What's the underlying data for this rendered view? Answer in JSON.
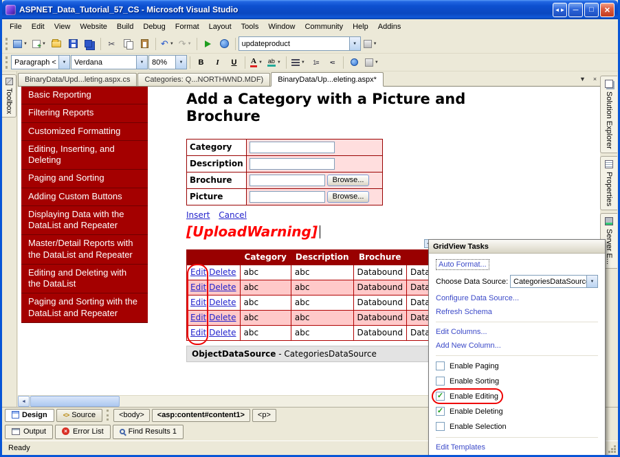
{
  "window": {
    "title": "ASPNET_Data_Tutorial_57_CS - Microsoft Visual Studio"
  },
  "menu": {
    "items": [
      "File",
      "Edit",
      "View",
      "Website",
      "Build",
      "Debug",
      "Format",
      "Layout",
      "Tools",
      "Window",
      "Community",
      "Help",
      "Addins"
    ]
  },
  "toolbar1": {
    "combo_value": "updateproduct"
  },
  "toolbar2": {
    "block_format": "Paragraph <",
    "font": "Verdana",
    "font_size": "80%",
    "bold": "B",
    "italic": "I",
    "underline": "U"
  },
  "tabstrip": {
    "tabs": [
      "BinaryData/Upd...leting.aspx.cs",
      "Categories: Q...NORTHWND.MDF)",
      "BinaryData/Up...eleting.aspx*"
    ]
  },
  "toolbox": {
    "label": "Toolbox"
  },
  "right_tabs": [
    "Solution Explorer",
    "Properties",
    "Server E..."
  ],
  "designer": {
    "nav_items": [
      "Basic Reporting",
      "Filtering Reports",
      "Customized Formatting",
      "Editing, Inserting, and Deleting",
      "Paging and Sorting",
      "Adding Custom Buttons",
      "Displaying Data with the DataList and Repeater",
      "Master/Detail Reports with the DataList and Repeater",
      "Editing and Deleting with the DataList",
      "Paging and Sorting with the DataList and Repeater"
    ],
    "heading": "Add a Category with a Picture and Brochure",
    "form": {
      "labels": [
        "Category",
        "Description",
        "Brochure",
        "Picture"
      ],
      "browse_label": "Browse..."
    },
    "links": {
      "insert": "Insert",
      "cancel": "Cancel"
    },
    "upload_warning": "[UploadWarning]",
    "grid": {
      "headers": [
        "",
        "Category",
        "Description",
        "Brochure",
        ""
      ],
      "rows": [
        [
          "Edit",
          "Delete",
          "abc",
          "abc",
          "Databound",
          "Databound"
        ],
        [
          "Edit",
          "Delete",
          "abc",
          "abc",
          "Databound",
          "Databound"
        ],
        [
          "Edit",
          "Delete",
          "abc",
          "abc",
          "Databound",
          "Databound"
        ],
        [
          "Edit",
          "Delete",
          "abc",
          "abc",
          "Databound",
          "Databound"
        ],
        [
          "Edit",
          "Delete",
          "abc",
          "abc",
          "Databound",
          "Databound"
        ]
      ]
    },
    "datasource": {
      "name": "ObjectDataSource",
      "rest": " - CategoriesDataSource"
    }
  },
  "smart_panel": {
    "title": "GridView Tasks",
    "auto_format": "Auto Format...",
    "choose_label": "Choose Data Source:",
    "choose_value": "CategoriesDataSource",
    "links": [
      "Configure Data Source...",
      "Refresh Schema",
      "Edit Columns...",
      "Add New Column..."
    ],
    "checkboxes": [
      {
        "label": "Enable Paging",
        "mark": ""
      },
      {
        "label": "Enable Sorting",
        "mark": ""
      },
      {
        "label": "Enable Editing",
        "mark": "✓"
      },
      {
        "label": "Enable Deleting",
        "mark": "✓"
      },
      {
        "label": "Enable Selection",
        "mark": ""
      }
    ],
    "edit_templates": "Edit Templates"
  },
  "bottom": {
    "design": "Design",
    "source": "Source",
    "tags": [
      "<body>",
      "<asp:content#content1>",
      "<p>"
    ],
    "panels": [
      "Output",
      "Error List",
      "Find Results 1"
    ],
    "status": "Ready"
  },
  "colors": {
    "nav_red": "#A40000",
    "grid_header_red": "#990000",
    "row_pink": "#FFC9C9",
    "form_pink": "#FFDEDE",
    "warning_red": "#FF0000",
    "link_blue": "#2222CC",
    "annotation_red": "#EE0000"
  }
}
